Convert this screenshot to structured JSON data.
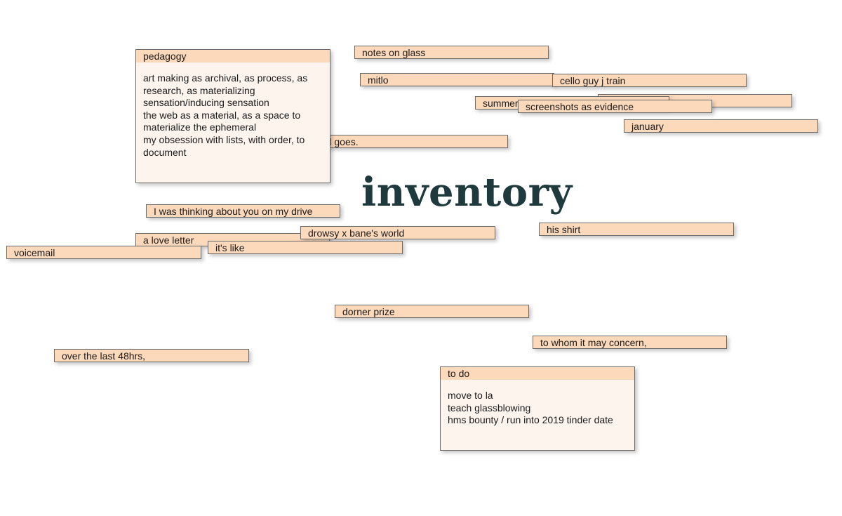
{
  "page": {
    "title": "inventory"
  },
  "notes": {
    "notes_on_glass": "notes on glass",
    "mitlo": "mitlo",
    "cello_guy": "cello guy j train",
    "hidden_note": "",
    "summer": "summer to read",
    "screenshots": "screenshots as evidence",
    "january": "january",
    "comes_and_goes": "the way it comes and goes.",
    "thinking": "I was thinking about you on my drive",
    "drowsy": "drowsy x bane's world",
    "love_letter": "a love letter",
    "its_like": "it's like",
    "voicemail": "voicemail",
    "his_shirt": "his shirt",
    "dorner": "dorner prize",
    "whom": "to whom it may concern,",
    "over48": "over the last 48hrs,"
  },
  "pedagogy": {
    "header": "pedagogy",
    "lines": [
      "art making as archival, as process, as research, as materializing sensation/inducing sensation",
      "the web as a material, as a space to materialize the ephemeral",
      "my obsession with lists, with order, to document"
    ]
  },
  "todo": {
    "header": "to do",
    "lines": [
      "move to la",
      "teach glassblowing",
      "hms bounty / run into 2019 tinder date"
    ]
  }
}
